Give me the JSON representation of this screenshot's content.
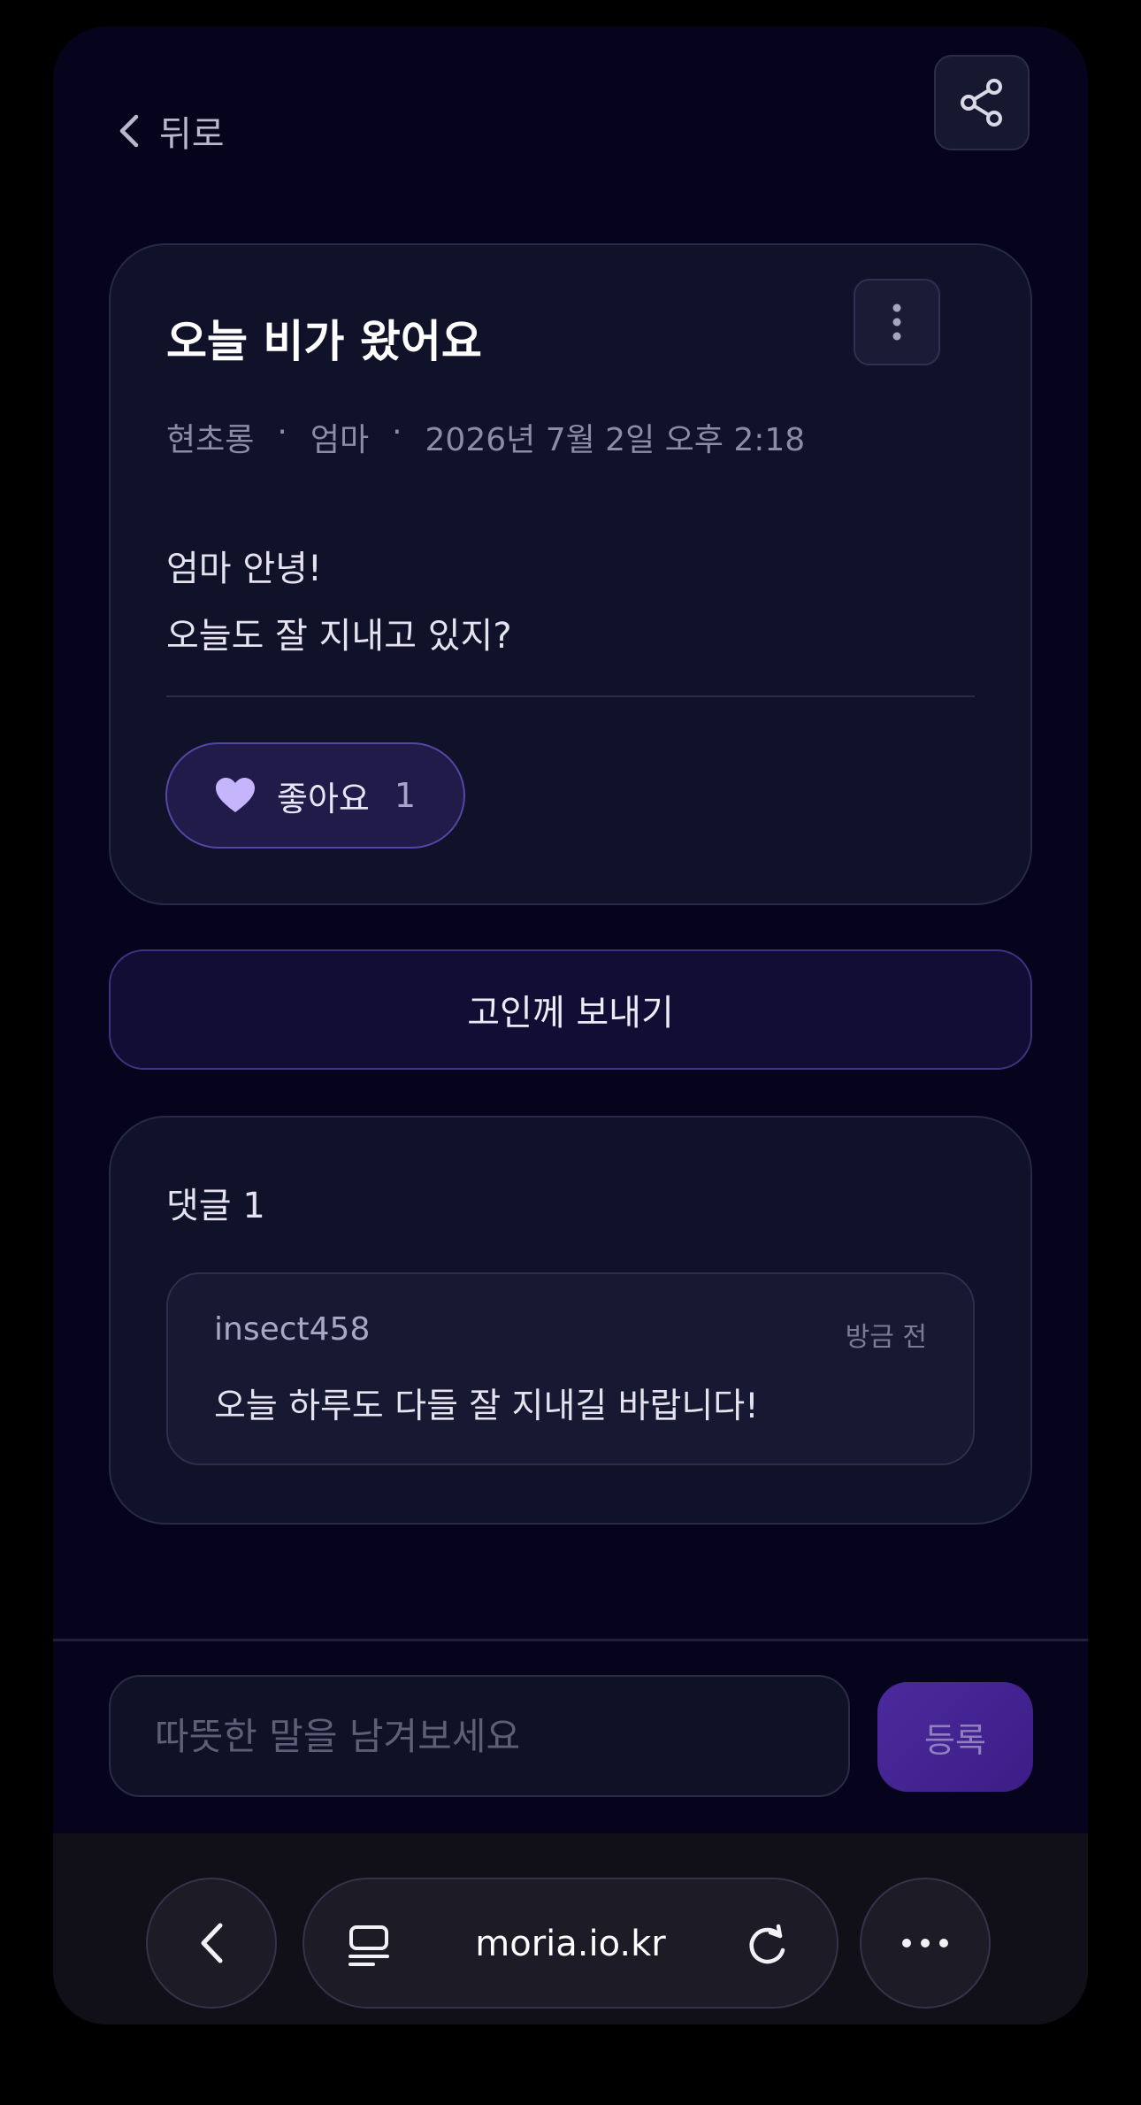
{
  "header": {
    "back_label": "뒤로"
  },
  "post": {
    "title": "오늘 비가 왔어요",
    "author": "현초롱",
    "recipient": "엄마",
    "date": "2026년 7월 2일 오후 2:18",
    "body_lines": [
      "엄마 안녕!",
      "오늘도 잘 지내고 있지?"
    ],
    "like_label": "좋아요",
    "like_count": "1"
  },
  "send_button_label": "고인께 보내기",
  "comments": {
    "title": "댓글 1",
    "items": [
      {
        "author": "insect458",
        "time": "방금 전",
        "text": "오늘 하루도 다들 잘 지내길 바랍니다!"
      }
    ]
  },
  "comment_input": {
    "placeholder": "따뜻한 말을 남겨보세요",
    "submit_label": "등록"
  },
  "browser": {
    "url": "moria.io.kr"
  },
  "colors": {
    "accent": "#c4b5fd",
    "background": "#05041c",
    "card": "#10122a"
  },
  "icons": [
    "chevron-left-icon",
    "share-icon",
    "more-vertical-icon",
    "heart-icon",
    "reader-icon",
    "reload-icon",
    "more-horizontal-icon"
  ]
}
